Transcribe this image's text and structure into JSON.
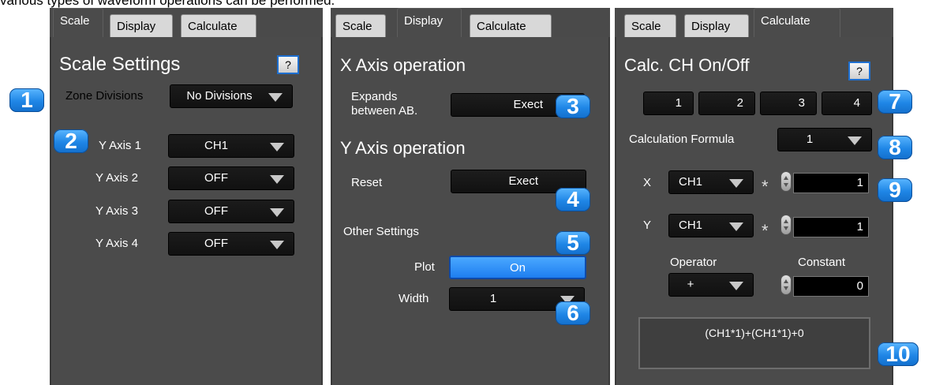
{
  "caption": "various types of waveform operations can be performed.",
  "tabs": [
    "Scale",
    "Display",
    "Calculate"
  ],
  "scale_panel": {
    "title": "Scale Settings",
    "help_label": "?",
    "zone_divisions_label": "Zone Divisions",
    "zone_divisions_value": "No Divisions",
    "y_axes": [
      {
        "label": "Y Axis 1",
        "value": "CH1"
      },
      {
        "label": "Y Axis 2",
        "value": "OFF"
      },
      {
        "label": "Y Axis 3",
        "value": "OFF"
      },
      {
        "label": "Y Axis 4",
        "value": "OFF"
      }
    ]
  },
  "display_panel": {
    "x_title": "X Axis operation",
    "expands_label_line1": "Expands",
    "expands_label_line2": "between AB.",
    "exect_label": "Exect",
    "y_title": "Y Axis operation",
    "reset_label": "Reset",
    "reset_exect_label": "Exect",
    "other_label": "Other Settings",
    "plot_label": "Plot",
    "plot_value": "On",
    "width_label": "Width",
    "width_value": "1"
  },
  "calc_panel": {
    "title": "Calc. CH On/Off",
    "help_label": "?",
    "channels": [
      "1",
      "2",
      "3",
      "4"
    ],
    "formula_label": "Calculation Formula",
    "formula_value": "1",
    "x_label": "X",
    "x_channel": "CH1",
    "x_factor": "1",
    "y_label": "Y",
    "y_channel": "CH1",
    "y_factor": "1",
    "mult_symbol": "*",
    "operator_label": "Operator",
    "operator_value": "+",
    "constant_label": "Constant",
    "constant_value": "0",
    "formula_display": "(CH1*1)+(CH1*1)+0"
  },
  "callouts": [
    "1",
    "2",
    "3",
    "4",
    "5",
    "6",
    "7",
    "8",
    "9",
    "10"
  ]
}
